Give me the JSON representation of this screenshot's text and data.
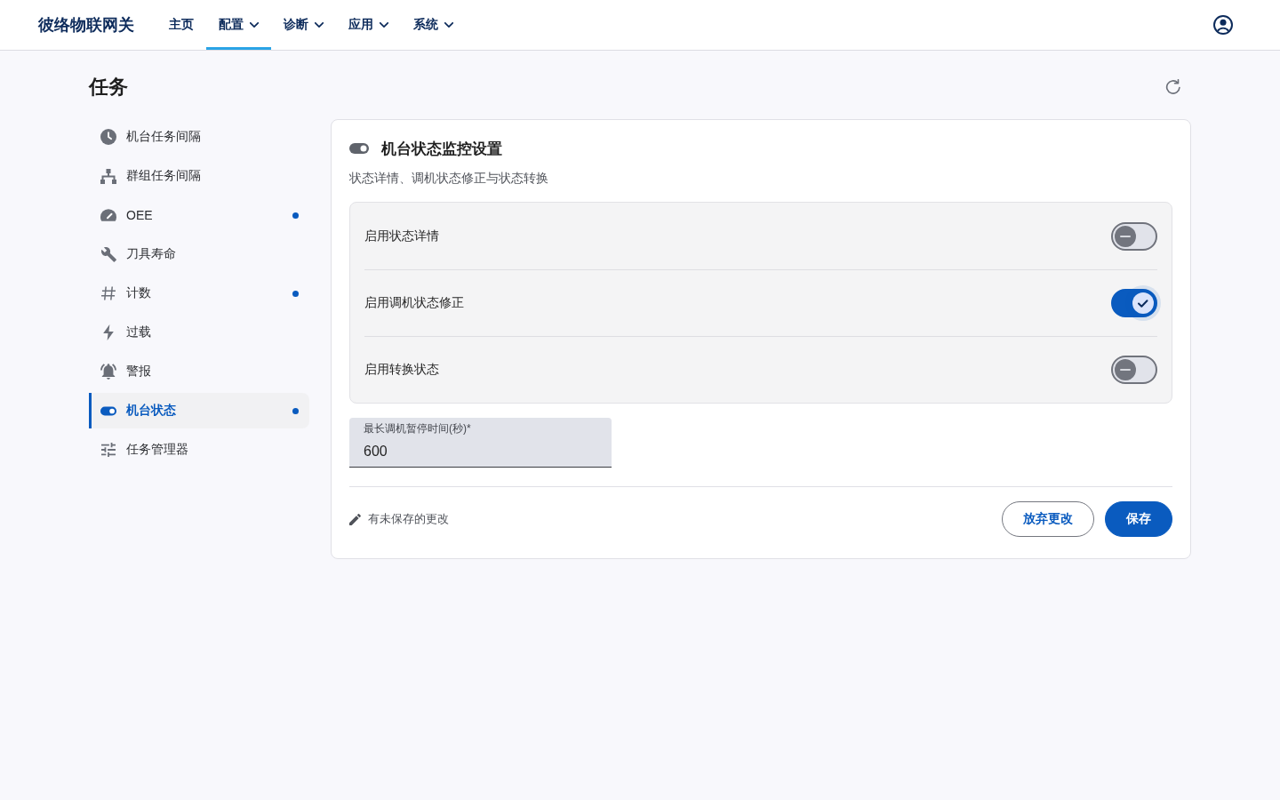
{
  "app": {
    "title": "彼络物联网关"
  },
  "nav": [
    {
      "label": "主页",
      "dropdown": false,
      "selected": false
    },
    {
      "label": "配置",
      "dropdown": true,
      "selected": true
    },
    {
      "label": "诊断",
      "dropdown": true,
      "selected": false
    },
    {
      "label": "应用",
      "dropdown": true,
      "selected": false
    },
    {
      "label": "系统",
      "dropdown": true,
      "selected": false
    }
  ],
  "page": {
    "title": "任务"
  },
  "sidebar": {
    "items": [
      {
        "label": "机台任务间隔",
        "selected": false,
        "modified": false
      },
      {
        "label": "群组任务间隔",
        "selected": false,
        "modified": false
      },
      {
        "label": "OEE",
        "selected": false,
        "modified": true
      },
      {
        "label": "刀具寿命",
        "selected": false,
        "modified": false
      },
      {
        "label": "计数",
        "selected": false,
        "modified": true
      },
      {
        "label": "过载",
        "selected": false,
        "modified": false
      },
      {
        "label": "警报",
        "selected": false,
        "modified": false
      },
      {
        "label": "机台状态",
        "selected": true,
        "modified": true
      },
      {
        "label": "任务管理器",
        "selected": false,
        "modified": false
      }
    ]
  },
  "panel": {
    "title": "机台状态监控设置",
    "subtitle": "状态详情、调机状态修正与状态转换",
    "toggles": [
      {
        "label": "启用状态详情",
        "on": false
      },
      {
        "label": "启用调机状态修正",
        "on": true
      },
      {
        "label": "启用转换状态",
        "on": false
      }
    ],
    "field": {
      "label": "最长调机暂停时间(秒)*",
      "value": "600"
    },
    "footer": {
      "status": "有未保存的更改",
      "buttons": [
        {
          "label": "放弃更改",
          "kind": "secondary"
        },
        {
          "label": "保存",
          "kind": "primary"
        }
      ]
    }
  }
}
